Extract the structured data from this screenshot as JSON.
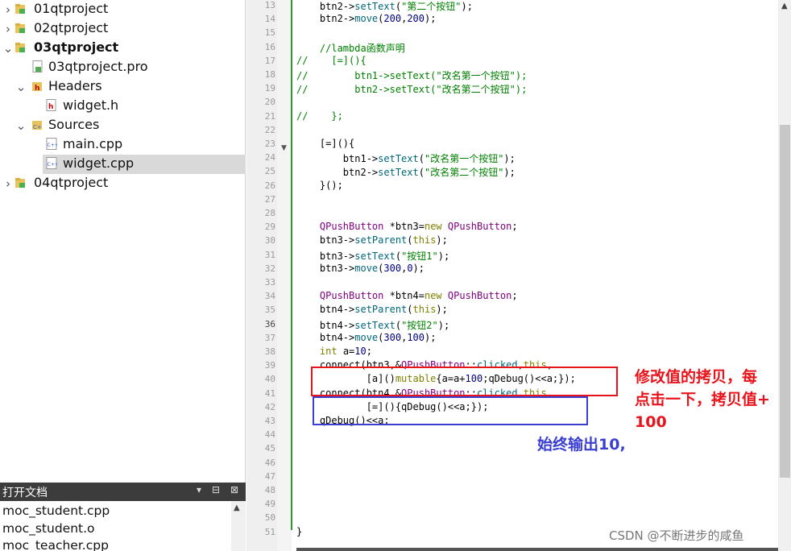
{
  "project_tree": {
    "items": [
      {
        "label": "01qtproject",
        "icon": "qt-project-folder-icon",
        "arrow": "collapsed"
      },
      {
        "label": "02qtproject",
        "icon": "qt-project-folder-icon",
        "arrow": "collapsed"
      },
      {
        "label": "03qtproject",
        "icon": "qt-project-folder-icon",
        "arrow": "expanded"
      },
      {
        "label": "03qtproject.pro",
        "icon": "pro-file-icon",
        "arrow": "none"
      },
      {
        "label": "Headers",
        "icon": "headers-folder-icon",
        "arrow": "expanded"
      },
      {
        "label": "widget.h",
        "icon": "header-file-icon",
        "arrow": "none"
      },
      {
        "label": "Sources",
        "icon": "sources-folder-icon",
        "arrow": "expanded"
      },
      {
        "label": "main.cpp",
        "icon": "cpp-file-icon",
        "arrow": "none"
      },
      {
        "label": "widget.cpp",
        "icon": "cpp-file-icon",
        "arrow": "none"
      },
      {
        "label": "04qtproject",
        "icon": "qt-project-folder-icon",
        "arrow": "collapsed"
      }
    ]
  },
  "open_documents": {
    "title": "打开文档",
    "items": [
      "moc_student.cpp",
      "moc_student.o",
      "moc_teacher.cpp"
    ]
  },
  "editor": {
    "lines": [
      {
        "n": "13",
        "code": "    btn2->setText(\"第二个按钮\");"
      },
      {
        "n": "14",
        "code": "    btn2->move(200,200);"
      },
      {
        "n": "15",
        "code": ""
      },
      {
        "n": "16",
        "code": "    //lambda函数声明"
      },
      {
        "n": "17",
        "code": "//    [=](){"
      },
      {
        "n": "18",
        "code": "//        btn1->setText(\"改名第一个按钮\");"
      },
      {
        "n": "19",
        "code": "//        btn2->setText(\"改名第二个按钮\");"
      },
      {
        "n": "20",
        "code": ""
      },
      {
        "n": "21",
        "code": "//    };"
      },
      {
        "n": "22",
        "code": ""
      },
      {
        "n": "23",
        "code": "    [=](){"
      },
      {
        "n": "24",
        "code": "        btn1->setText(\"改名第一个按钮\");"
      },
      {
        "n": "25",
        "code": "        btn2->setText(\"改名第二个按钮\");"
      },
      {
        "n": "26",
        "code": "    }();"
      },
      {
        "n": "27",
        "code": ""
      },
      {
        "n": "28",
        "code": ""
      },
      {
        "n": "29",
        "code": "    QPushButton *btn3=new QPushButton;"
      },
      {
        "n": "30",
        "code": "    btn3->setParent(this);"
      },
      {
        "n": "31",
        "code": "    btn3->setText(\"按钮1\");"
      },
      {
        "n": "32",
        "code": "    btn3->move(300,0);"
      },
      {
        "n": "33",
        "code": ""
      },
      {
        "n": "34",
        "code": "    QPushButton *btn4=new QPushButton;"
      },
      {
        "n": "35",
        "code": "    btn4->setParent(this);"
      },
      {
        "n": "36",
        "code": "    btn4->setText(\"按钮2\");"
      },
      {
        "n": "37",
        "code": "    btn4->move(300,100);"
      },
      {
        "n": "38",
        "code": "    int a=10;"
      },
      {
        "n": "39",
        "code": "    connect(btn3,&QPushButton::clicked,this,"
      },
      {
        "n": "40",
        "code": "            [a]()mutable{a=a+100;qDebug()<<a;});"
      },
      {
        "n": "41",
        "code": "    connect(btn4,&QPushButton::clicked,this,"
      },
      {
        "n": "42",
        "code": "            [=](){qDebug()<<a;});"
      },
      {
        "n": "43",
        "code": "    qDebug()<<a;"
      },
      {
        "n": "44",
        "code": ""
      },
      {
        "n": "45",
        "code": ""
      },
      {
        "n": "46",
        "code": ""
      },
      {
        "n": "47",
        "code": ""
      },
      {
        "n": "48",
        "code": ""
      },
      {
        "n": "49",
        "code": ""
      },
      {
        "n": "50",
        "code": ""
      },
      {
        "n": "51",
        "code": "}"
      }
    ],
    "current_line": "36"
  },
  "annotations": {
    "red_note": [
      "修改值的拷贝，每",
      "点击一下，拷贝值+",
      "100"
    ],
    "blue_note": "始终输出10,",
    "red_color": "#e8141c",
    "blue_color": "#3a3fd0"
  },
  "watermark": "CSDN @不断进步的咸鱼"
}
